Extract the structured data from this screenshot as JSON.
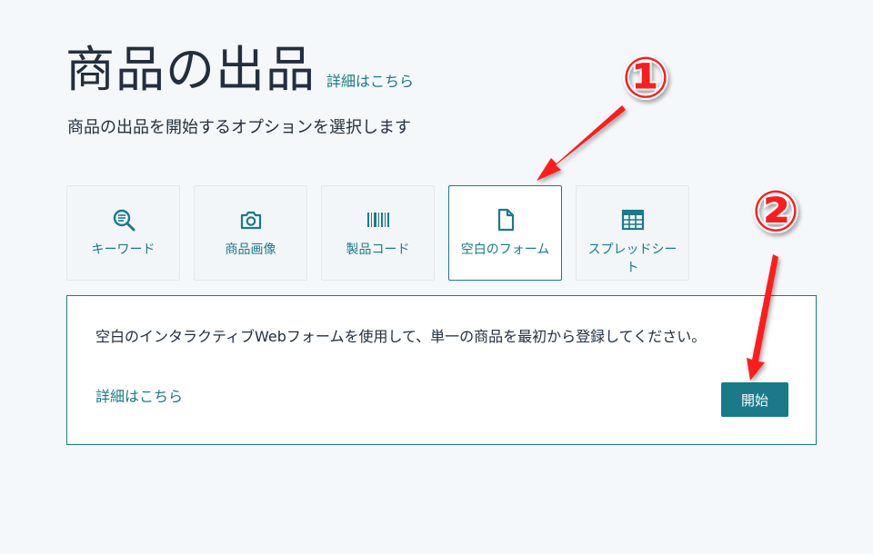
{
  "header": {
    "title": "商品の出品",
    "learn_more": "詳細はこちら",
    "subtitle": "商品の出品を開始するオプションを選択します"
  },
  "options": [
    {
      "label": "キーワード",
      "icon": "keyword-search-icon",
      "selected": false
    },
    {
      "label": "商品画像",
      "icon": "camera-icon",
      "selected": false
    },
    {
      "label": "製品コード",
      "icon": "barcode-icon",
      "selected": false
    },
    {
      "label": "空白のフォーム",
      "icon": "document-icon",
      "selected": true
    },
    {
      "label": "スプレッドシート",
      "icon": "spreadsheet-icon",
      "selected": false
    }
  ],
  "detail": {
    "description": "空白のインタラクティブWebフォームを使用して、単一の商品を最初から登録してください。",
    "learn_more": "詳細はこちら",
    "start_button": "開始"
  },
  "annotations": {
    "marker_1": "①",
    "marker_2": "②",
    "arrow_color": "#ff1a1a"
  },
  "colors": {
    "accent": "#1a7a8a",
    "background": "#f5f8fa",
    "text": "#232f3e"
  }
}
